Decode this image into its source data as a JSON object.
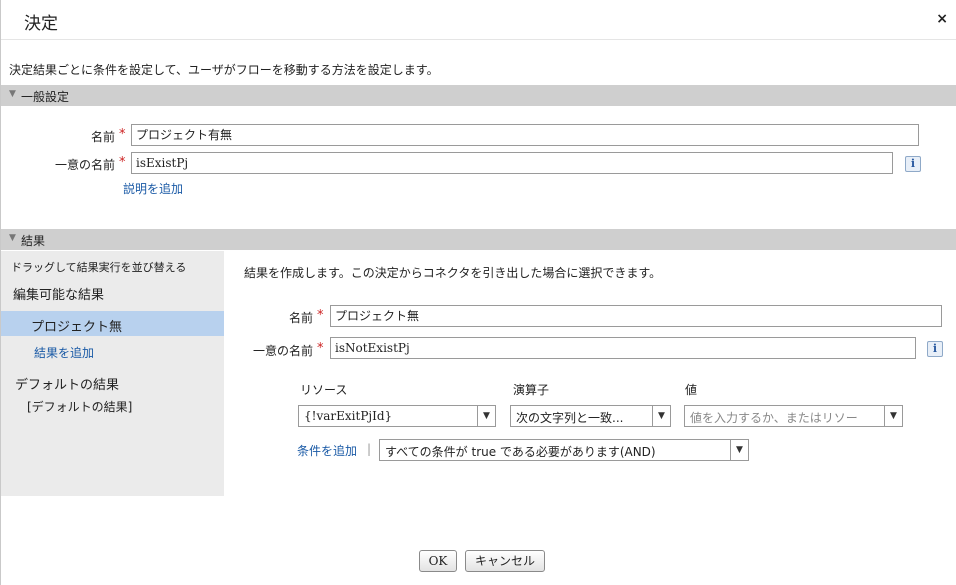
{
  "dialog": {
    "title": "決定",
    "close_label": "×",
    "description": "決定結果ごとに条件を設定して、ユーザがフローを移動する方法を設定します。"
  },
  "general": {
    "section_label": "一般設定",
    "name_label": "名前",
    "name_value": "プロジェクト有無",
    "unique_name_label": "一意の名前",
    "unique_name_value": "isExistPj",
    "add_description_link": "説明を追加",
    "info_label": "i"
  },
  "outcomes": {
    "section_label": "結果",
    "reorder_hint": "ドラッグして結果実行を並び替える",
    "editable_heading": "編集可能な結果",
    "selected_outcome": "プロジェクト無",
    "add_outcome_link": "結果を追加",
    "default_heading": "デフォルトの結果",
    "default_item": "[デフォルトの結果]"
  },
  "outcome_detail": {
    "intro": "結果を作成します。この決定からコネクタを引き出した場合に選択できます。",
    "name_label": "名前",
    "name_value": "プロジェクト無",
    "unique_name_label": "一意の名前",
    "unique_name_value": "isNotExistPj",
    "info_label": "i",
    "col_resource": "リソース",
    "col_operator": "演算子",
    "col_value": "値",
    "resource_value": "{!varExitPjId}",
    "operator_value": "次の文字列と一致...",
    "value_placeholder": "値を入力するか、またはリソー",
    "add_condition_link": "条件を追加",
    "separator": "|",
    "logic_value": "すべての条件が true である必要があります(AND)"
  },
  "footer": {
    "ok_label": "OK",
    "cancel_label": "キャンセル"
  },
  "colors": {
    "section_bar": "#cfcfcf",
    "left_panel": "#ebebeb",
    "selected_row": "#b8d1ee",
    "link": "#1a5aa6",
    "required": "#cc2020"
  },
  "icons": {
    "close": "close-icon",
    "collapse": "triangle-down-icon",
    "info": "info-icon",
    "dropdown": "chevron-down-icon"
  }
}
